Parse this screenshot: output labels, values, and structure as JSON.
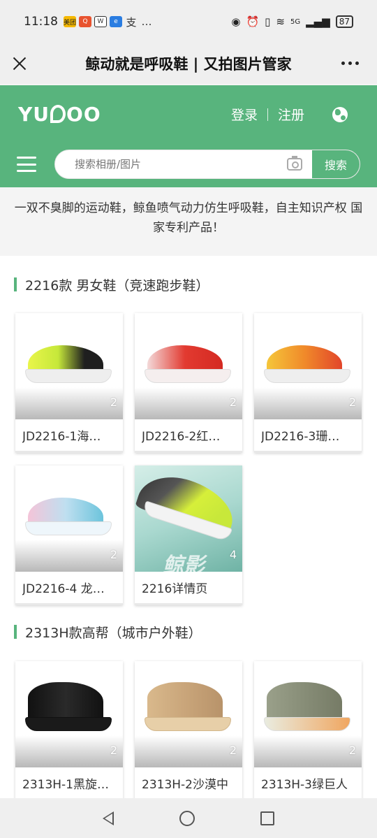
{
  "status_bar": {
    "time": "11:18",
    "apps": [
      "美团",
      "Q",
      "W",
      "e",
      "支",
      "…"
    ],
    "signal": "5G",
    "battery": "87"
  },
  "title_bar": {
    "title": "鲸动就是呼吸鞋 | 又拍图片管家"
  },
  "header": {
    "logo": "yupoo",
    "login": "登录",
    "register": "注册",
    "search_placeholder": "搜索相册/图片",
    "search_button": "搜索",
    "brand_color": "#58b47d"
  },
  "description": "一双不臭脚的运动鞋，鲸鱼喷气动力仿生呼吸鞋，自主知识产权 国家专利产品！",
  "sections": [
    {
      "title": "2216款 男女鞋（竞速跑步鞋）",
      "cards": [
        {
          "title": "JD2216-1海…",
          "count": "2"
        },
        {
          "title": "JD2216-2红…",
          "count": "2"
        },
        {
          "title": "JD2216-3珊…",
          "count": "2"
        },
        {
          "title": "JD2216-4 龙…",
          "count": "2"
        },
        {
          "title": "2216详情页",
          "count": "4",
          "watermark": "鲸影"
        }
      ]
    },
    {
      "title": "2313H款高帮（城市户外鞋）",
      "cards": [
        {
          "title": "2313H-1黑旋…",
          "count": "2"
        },
        {
          "title": "2313H-2沙漠中",
          "count": "2"
        },
        {
          "title": "2313H-3绿巨人",
          "count": "2"
        }
      ]
    }
  ]
}
